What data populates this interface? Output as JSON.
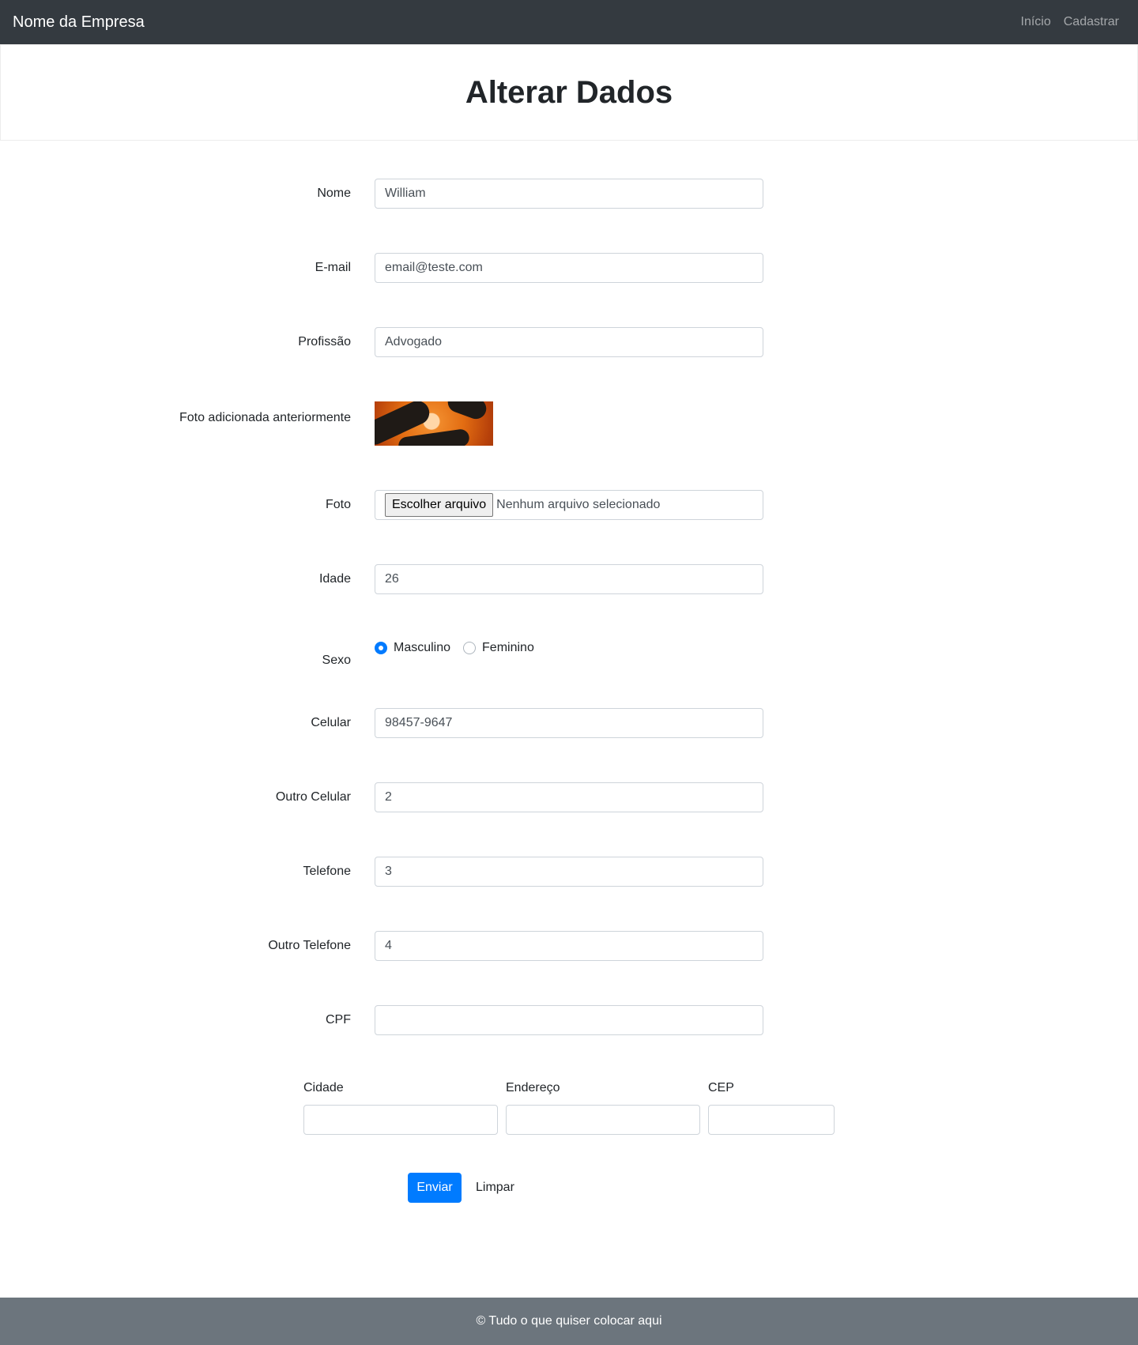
{
  "navbar": {
    "brand": "Nome da Empresa",
    "links": [
      "Início",
      "Cadastrar"
    ]
  },
  "header": {
    "title": "Alterar Dados"
  },
  "form": {
    "nome": {
      "label": "Nome",
      "value": "William"
    },
    "email": {
      "label": "E-mail",
      "value": "email@teste.com"
    },
    "profissao": {
      "label": "Profissão",
      "value": "Advogado"
    },
    "foto_anterior": {
      "label": "Foto adicionada anteriormente"
    },
    "foto": {
      "label": "Foto",
      "button": "Escolher arquivo",
      "status": "Nenhum arquivo selecionado"
    },
    "idade": {
      "label": "Idade",
      "value": "26"
    },
    "sexo": {
      "label": "Sexo",
      "options": [
        "Masculino",
        "Feminino"
      ],
      "selected": "Masculino"
    },
    "celular": {
      "label": "Celular",
      "value": "98457-9647"
    },
    "outro_celular": {
      "label": "Outro Celular",
      "value": "2"
    },
    "telefone": {
      "label": "Telefone",
      "value": "3"
    },
    "outro_telefone": {
      "label": "Outro Telefone",
      "value": "4"
    },
    "cpf": {
      "label": "CPF",
      "value": ""
    },
    "cidade": {
      "label": "Cidade",
      "value": ""
    },
    "endereco": {
      "label": "Endereço",
      "value": ""
    },
    "cep": {
      "label": "CEP",
      "value": ""
    },
    "submit_label": "Enviar",
    "reset_label": "Limpar"
  },
  "footer": {
    "text": "© Tudo o que quiser colocar aqui"
  },
  "colors": {
    "navbar": "#343a40",
    "primary": "#007bff",
    "footer": "#6c757d"
  },
  "icons": {
    "radio_checked": "radio-checked-icon",
    "radio_unchecked": "radio-unchecked-icon"
  }
}
